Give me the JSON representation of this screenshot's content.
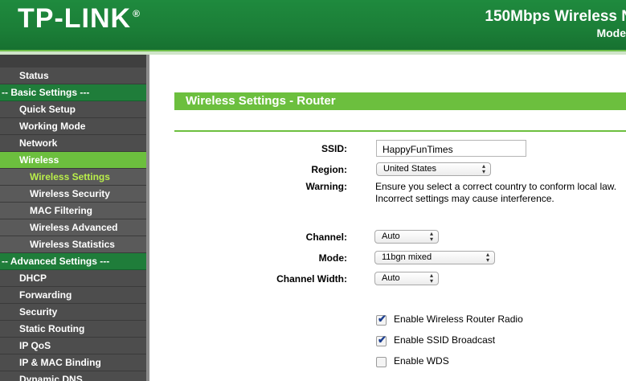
{
  "header": {
    "logo": "TP-LINK",
    "logo_reg": "®",
    "product": "150Mbps Wireless N",
    "model_line": "Mode"
  },
  "sidebar": {
    "items": [
      {
        "label": "Status"
      },
      {
        "label": "-- Basic Settings ---"
      },
      {
        "label": "Quick Setup"
      },
      {
        "label": "Working Mode"
      },
      {
        "label": "Network"
      },
      {
        "label": "Wireless"
      },
      {
        "label": "Wireless Settings"
      },
      {
        "label": "Wireless Security"
      },
      {
        "label": "MAC Filtering"
      },
      {
        "label": "Wireless Advanced"
      },
      {
        "label": "Wireless Statistics"
      },
      {
        "label": "-- Advanced Settings ---"
      },
      {
        "label": "DHCP"
      },
      {
        "label": "Forwarding"
      },
      {
        "label": "Security"
      },
      {
        "label": "Static Routing"
      },
      {
        "label": "IP QoS"
      },
      {
        "label": "IP & MAC Binding"
      },
      {
        "label": "Dynamic DNS"
      }
    ]
  },
  "main": {
    "title": "Wireless Settings - Router",
    "ssid_label": "SSID:",
    "ssid_value": "HappyFunTimes",
    "region_label": "Region:",
    "region_value": "United States",
    "warning_label": "Warning:",
    "warning_text_1": "Ensure you select a correct country to conform local law.",
    "warning_text_2": "Incorrect settings may cause interference.",
    "channel_label": "Channel:",
    "channel_value": "Auto",
    "mode_label": "Mode:",
    "mode_value": "11bgn mixed",
    "width_label": "Channel Width:",
    "width_value": "Auto",
    "enable_radio": {
      "label": "Enable Wireless Router Radio",
      "checked": true
    },
    "enable_ssid": {
      "label": "Enable SSID Broadcast",
      "checked": true
    },
    "enable_wds": {
      "label": "Enable WDS",
      "checked": false
    }
  },
  "colors": {
    "brand_green": "#1b7e37",
    "accent_green": "#6cbf3e",
    "selected_text": "#b9ee4a",
    "sidebar_bg": "#4d4d4d"
  }
}
